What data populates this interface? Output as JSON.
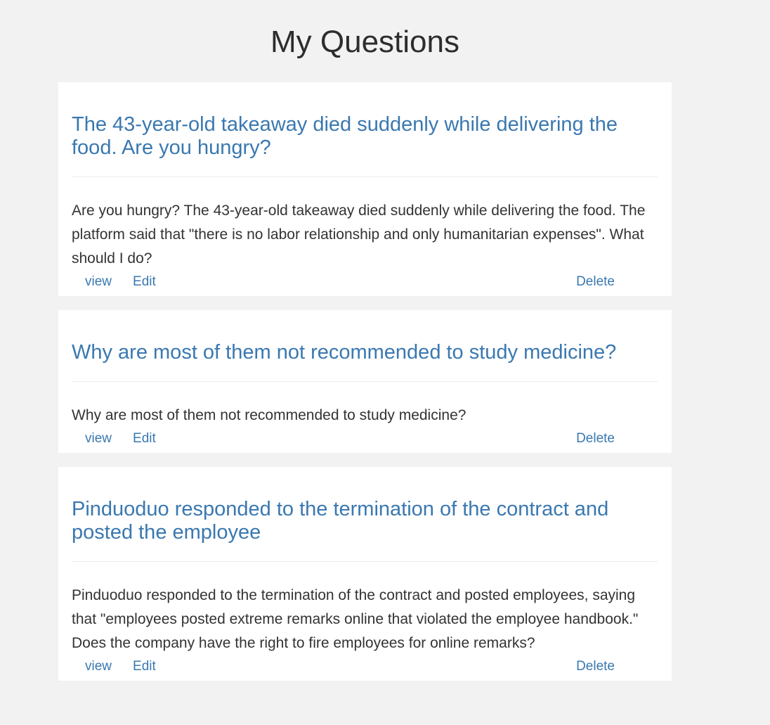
{
  "page": {
    "title": "My Questions"
  },
  "questions": [
    {
      "title": "The 43-year-old takeaway died suddenly while delivering the food. Are you hungry?",
      "body": "Are you hungry? The 43-year-old takeaway died suddenly while delivering the food. The platform said that \"there is no labor relationship and only humanitarian expenses\". What should I do?",
      "actions": {
        "view": "view",
        "edit": "Edit",
        "delete": "Delete"
      }
    },
    {
      "title": "Why are most of them not recommended to study medicine?",
      "body": "Why are most of them not recommended to study medicine?",
      "actions": {
        "view": "view",
        "edit": "Edit",
        "delete": "Delete"
      }
    },
    {
      "title": "Pinduoduo responded to the termination of the contract and posted the employee",
      "body": "Pinduoduo responded to the termination of the contract and posted employees, saying that \"employees posted extreme remarks online that violated the employee handbook.\" Does the company have the right to fire employees for online remarks?",
      "actions": {
        "view": "view",
        "edit": "Edit",
        "delete": "Delete"
      }
    }
  ],
  "colors": {
    "background": "#f1f2f1",
    "card": "#ffffff",
    "link": "#3a78b0",
    "text": "#333333"
  }
}
